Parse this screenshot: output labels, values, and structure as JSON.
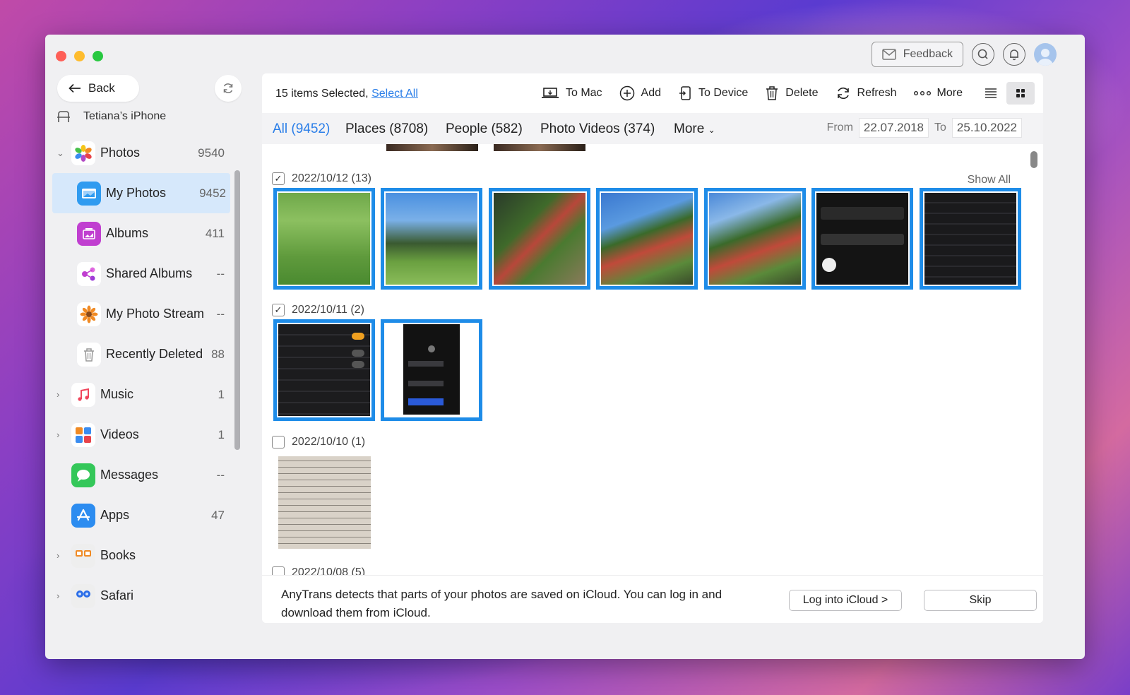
{
  "window": {
    "feedback_label": "Feedback"
  },
  "sidebar": {
    "back_label": "Back",
    "device_name": "Tetiana’s iPhone",
    "items": [
      {
        "label": "Photos",
        "count": "9540",
        "chevron": "⌄",
        "icon": "photos-icon"
      },
      {
        "label": "My Photos",
        "count": "9452",
        "chevron": "",
        "icon": "my-photos-icon"
      },
      {
        "label": "Albums",
        "count": "411",
        "chevron": "",
        "icon": "albums-icon"
      },
      {
        "label": "Shared Albums",
        "count": "--",
        "chevron": "",
        "icon": "shared-albums-icon"
      },
      {
        "label": "My Photo Stream",
        "count": "--",
        "chevron": "",
        "icon": "photo-stream-icon"
      },
      {
        "label": "Recently Deleted",
        "count": "88",
        "chevron": "",
        "icon": "trash-icon"
      },
      {
        "label": "Music",
        "count": "1",
        "chevron": "›",
        "icon": "music-icon"
      },
      {
        "label": "Videos",
        "count": "1",
        "chevron": "›",
        "icon": "videos-icon"
      },
      {
        "label": "Messages",
        "count": "--",
        "chevron": "",
        "icon": "messages-icon"
      },
      {
        "label": "Apps",
        "count": "47",
        "chevron": "",
        "icon": "apps-icon"
      },
      {
        "label": "Books",
        "count": "",
        "chevron": "›",
        "icon": "books-icon"
      },
      {
        "label": "Safari",
        "count": "",
        "chevron": "›",
        "icon": "safari-icon"
      }
    ]
  },
  "toolbar": {
    "selected_text": "15 items Selected, ",
    "select_all": "Select All",
    "actions": [
      "To Mac",
      "Add",
      "To Device",
      "Delete",
      "Refresh",
      "More"
    ]
  },
  "tabs": {
    "items": [
      "All (9452)",
      "Places (8708)",
      "People (582)",
      "Photo Videos (374)",
      "More"
    ],
    "from_label": "From",
    "from_date": "22.07.2018",
    "to_label": "To",
    "to_date": "25.10.2022"
  },
  "groups": [
    {
      "date": "2022/10/12 (13)",
      "checked": true,
      "show_all": "Show All"
    },
    {
      "date": "2022/10/11 (2)",
      "checked": true
    },
    {
      "date": "2022/10/10 (1)",
      "checked": false
    },
    {
      "date": "2022/10/08 (5)",
      "checked": false
    }
  ],
  "banner": {
    "text": "AnyTrans detects that parts of your photos are saved on iCloud. You can log in and download them from iCloud.",
    "login_label": "Log into iCloud >",
    "skip_label": "Skip"
  },
  "colors": {
    "accent": "#1e8ce8",
    "link": "#2a7ee8",
    "active_bg": "#d6e8fb"
  }
}
